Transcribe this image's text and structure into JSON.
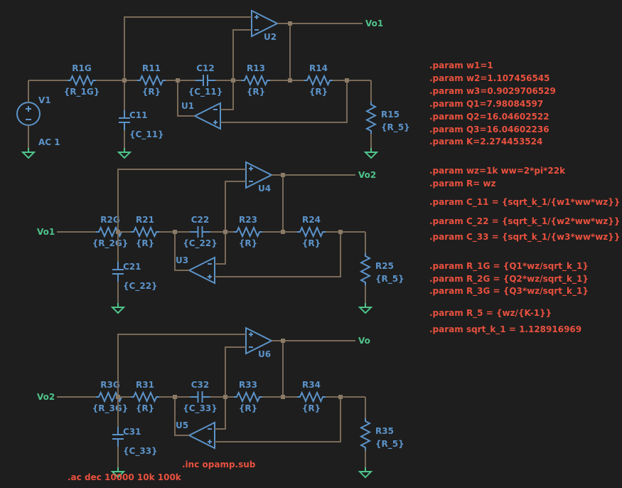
{
  "stages": [
    {
      "in_label": "",
      "out_label": "Vo1",
      "rin": {
        "ref": "R1G",
        "val": "{R_1G}"
      },
      "r1": {
        "ref": "R11",
        "val": "{R}"
      },
      "cs": {
        "ref": "C12",
        "val": "{C_11}"
      },
      "r3": {
        "ref": "R13",
        "val": "{R}"
      },
      "r4": {
        "ref": "R14",
        "val": "{R}"
      },
      "cg": {
        "ref": "C11",
        "val": "{C_11}"
      },
      "rl": {
        "ref": "R15",
        "val": "{R_5}"
      },
      "opa": "U2",
      "opb": "U1"
    },
    {
      "in_label": "Vo1",
      "out_label": "Vo2",
      "rin": {
        "ref": "R2G",
        "val": "{R_2G}"
      },
      "r1": {
        "ref": "R21",
        "val": "{R}"
      },
      "cs": {
        "ref": "C22",
        "val": "{C_22}"
      },
      "r3": {
        "ref": "R23",
        "val": "{R}"
      },
      "r4": {
        "ref": "R24",
        "val": "{R}"
      },
      "cg": {
        "ref": "C21",
        "val": "{C_22}"
      },
      "rl": {
        "ref": "R25",
        "val": "{R_5}"
      },
      "opa": "U4",
      "opb": "U3"
    },
    {
      "in_label": "Vo2",
      "out_label": "Vo",
      "rin": {
        "ref": "R3G",
        "val": "{R_3G}"
      },
      "r1": {
        "ref": "R31",
        "val": "{R}"
      },
      "cs": {
        "ref": "C32",
        "val": "{C_33}"
      },
      "r3": {
        "ref": "R33",
        "val": "{R}"
      },
      "r4": {
        "ref": "R34",
        "val": "{R}"
      },
      "cg": {
        "ref": "C31",
        "val": "{C_33}"
      },
      "rl": {
        "ref": "R35",
        "val": "{R_5}"
      },
      "opa": "U6",
      "opb": "U5"
    }
  ],
  "source": {
    "ref": "V1",
    "val": "AC 1"
  },
  "params": [
    ".param w1=1",
    ".param w2=1.107456545",
    ".param w3=0.9029706529",
    ".param Q1=7.98084597",
    ".param Q2=16.04602522",
    ".param Q3=16.04602236",
    ".param K=2.274453524",
    ".param wz=1k ww=2*pi*22k",
    ".param R= wz",
    ".param C_11 = {sqrt_k_1/{w1*ww*wz}}",
    ".param C_22 = {sqrt_k_1/{w2*ww*wz}}",
    ".param C_33 = {sqrt_k_1/{w3*ww*wz}}",
    ".param R_1G = {Q1*wz/sqrt_k_1}",
    ".param R_2G = {Q2*wz/sqrt_k_1}",
    ".param R_3G = {Q3*wz/sqrt_k_1}",
    ".param R_5 = {wz/{K-1}}",
    ".param sqrt_k_1 = 1.128916969"
  ],
  "include": ".inc opamp.sub",
  "ac": ".ac dec 10000 10k 100k"
}
